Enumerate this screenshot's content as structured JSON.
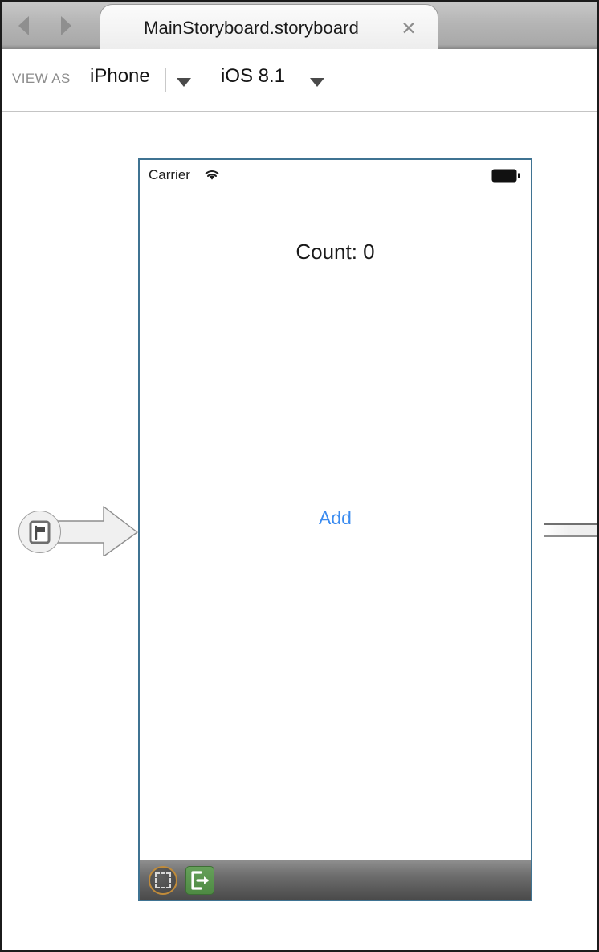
{
  "window": {
    "title": "MainStoryboard.storyboard"
  },
  "tabbar": {
    "back_icon": "triangle-left-icon",
    "forward_icon": "triangle-right-icon",
    "active_tab_label": "MainStoryboard.storyboard",
    "close_label": "✕"
  },
  "toolbar": {
    "view_as_label": "VIEW AS",
    "device_name": "iPhone",
    "os_version": "iOS 8.1",
    "device_caret": "▼",
    "os_caret": "▼",
    "landscape_icon": "device-landscape-icon",
    "portrait_icon": "device-portrait-icon"
  },
  "canvas": {
    "entry_point_icon": "storyboard-entry-point-flag-icon",
    "device": {
      "statusbar": {
        "carrier": "Carrier",
        "wifi_icon": "wifi-icon",
        "battery_icon": "battery-full-icon"
      },
      "count_label": "Count: 0",
      "add_button": "Add"
    },
    "dock": {
      "view_controller_icon": "view-controller-icon",
      "exit_icon": "exit-segue-icon"
    }
  },
  "colors": {
    "ios_tint_blue": "#3c8cf0",
    "device_border": "#3f7392",
    "dock_exit_green": "#4e8a43",
    "dock_vc_orange": "#c08b3a",
    "toolbar_label_gray": "#8c8c8c"
  }
}
